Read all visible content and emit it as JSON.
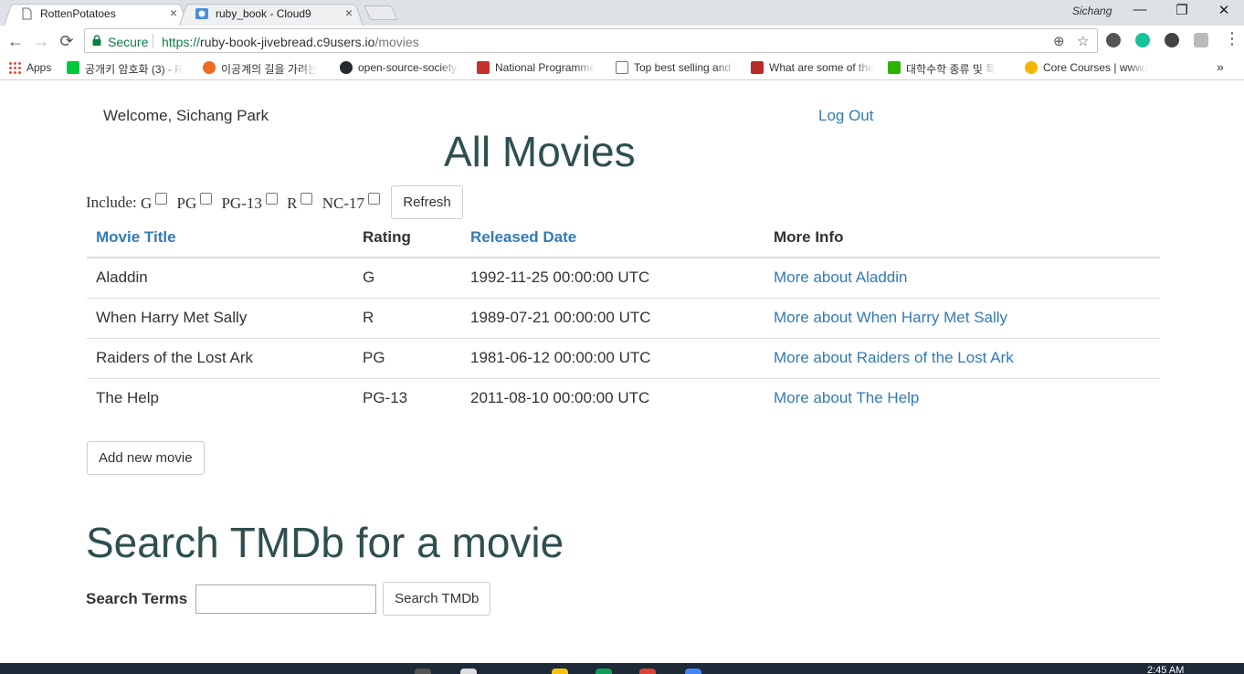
{
  "browser": {
    "tabs": [
      {
        "title": "RottenPotatoes",
        "close": "×"
      },
      {
        "title": "ruby_book - Cloud9",
        "close": "×"
      }
    ],
    "profile": "Sichang",
    "window_controls": {
      "minimize": "—",
      "maximize": "❐",
      "close": "✕"
    },
    "nav": {
      "back": "←",
      "forward": "→",
      "reload": "⟳"
    },
    "address": {
      "secure_label": "Secure",
      "scheme": "https://",
      "host": "ruby-book-jivebread.c9users.io",
      "path": "/movies"
    },
    "bookmarks": [
      {
        "label": "Apps",
        "icon": "apps-grid-icon"
      },
      {
        "label": "공개키 암호화 (3) - R",
        "icon": "blog-icon",
        "color": "#00c73c"
      },
      {
        "label": "이공계의 길을 가려는",
        "icon": "orange-circle-icon",
        "color": "#f06c1f"
      },
      {
        "label": "open-source-society/",
        "icon": "github-icon",
        "color": "#24292e"
      },
      {
        "label": "National Programme",
        "icon": "n-icon",
        "color": "#c4302b"
      },
      {
        "label": "Top best selling and l",
        "icon": "page-icon",
        "color": "#ffffff"
      },
      {
        "label": "What are some of the",
        "icon": "quora-icon",
        "color": "#b92b27"
      },
      {
        "label": "대학수학 종류 및 특",
        "icon": "green-book-icon",
        "color": "#2db400"
      },
      {
        "label": "Core Courses | www.r",
        "icon": "bee-icon",
        "color": "#f2b705"
      }
    ],
    "bookmarks_more": "»"
  },
  "page": {
    "welcome": "Welcome, Sichang Park",
    "logout": "Log Out",
    "title": "All Movies",
    "filter": {
      "include_label": "Include:",
      "ratings": [
        "G",
        "PG",
        "PG-13",
        "R",
        "NC-17"
      ],
      "refresh_label": "Refresh"
    },
    "table": {
      "headers": [
        "Movie Title",
        "Rating",
        "Released Date",
        "More Info"
      ],
      "rows": [
        {
          "title": "Aladdin",
          "rating": "G",
          "date": "1992-11-25 00:00:00 UTC",
          "more": "More about Aladdin"
        },
        {
          "title": "When Harry Met Sally",
          "rating": "R",
          "date": "1989-07-21 00:00:00 UTC",
          "more": "More about When Harry Met Sally"
        },
        {
          "title": "Raiders of the Lost Ark",
          "rating": "PG",
          "date": "1981-06-12 00:00:00 UTC",
          "more": "More about Raiders of the Lost Ark"
        },
        {
          "title": "The Help",
          "rating": "PG-13",
          "date": "2011-08-10 00:00:00 UTC",
          "more": "More about The Help"
        }
      ]
    },
    "add_movie_label": "Add new movie",
    "search": {
      "title": "Search TMDb for a movie",
      "label": "Search Terms",
      "value": "",
      "button": "Search TMDb"
    }
  },
  "taskbar": {
    "clock": "2:45 AM"
  },
  "colors": {
    "link": "#337ab7",
    "heading": "#2f4f4f",
    "secure": "#0b8043"
  }
}
